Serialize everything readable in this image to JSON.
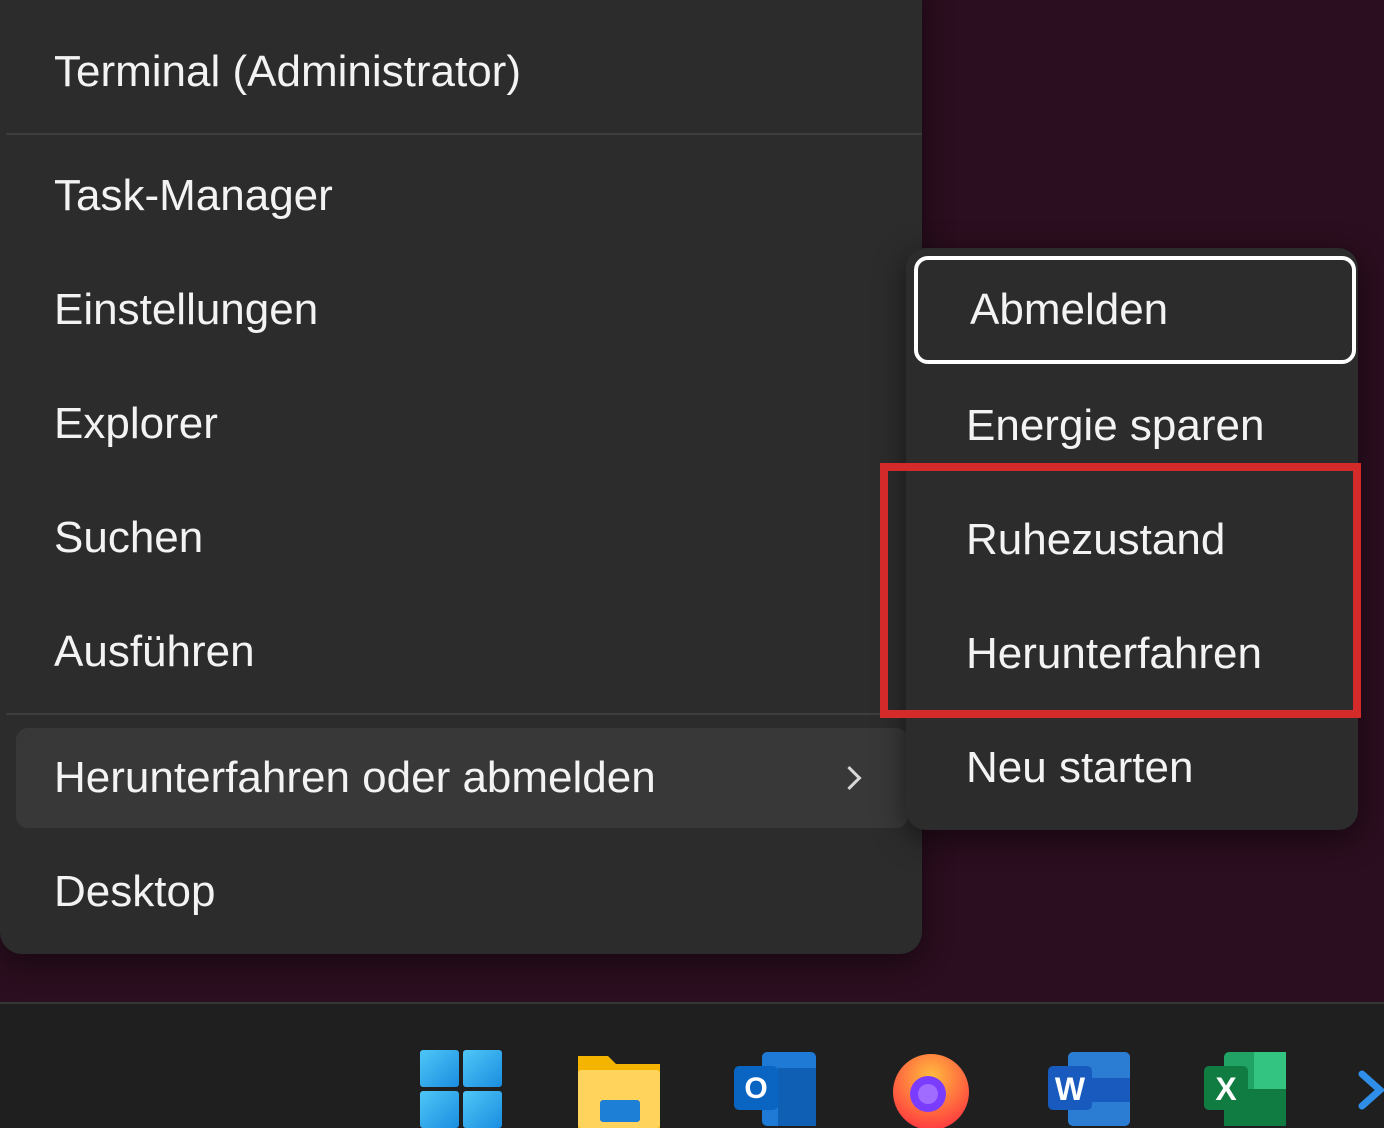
{
  "menu": {
    "items": [
      {
        "label": "Terminal (Administrator)"
      },
      {
        "label": "Task-Manager"
      },
      {
        "label": "Einstellungen"
      },
      {
        "label": "Explorer"
      },
      {
        "label": "Suchen"
      },
      {
        "label": "Ausführen"
      },
      {
        "label": "Herunterfahren oder abmelden"
      },
      {
        "label": "Desktop"
      }
    ]
  },
  "submenu": {
    "items": [
      {
        "label": "Abmelden"
      },
      {
        "label": "Energie sparen"
      },
      {
        "label": "Ruhezustand"
      },
      {
        "label": "Herunterfahren"
      },
      {
        "label": "Neu starten"
      }
    ]
  },
  "taskbar": {
    "icons": [
      "windows-start-icon",
      "file-explorer-icon",
      "outlook-icon",
      "firefox-icon",
      "word-icon",
      "excel-icon",
      "chevron-icon"
    ]
  },
  "colors": {
    "menu_bg": "#2c2c2c",
    "desktop_bg": "#2b0e1f",
    "highlight": "#d42a2a",
    "focus_outline": "#ffffff"
  }
}
